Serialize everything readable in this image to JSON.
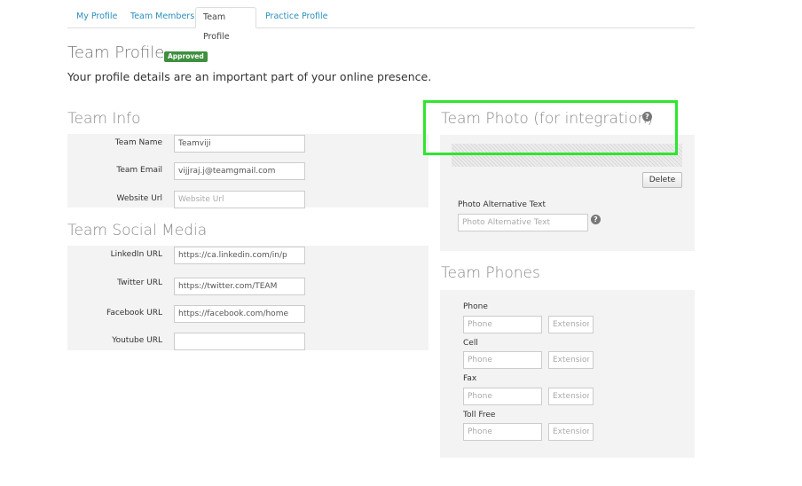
{
  "tabs": [
    {
      "label": "My Profile"
    },
    {
      "label": "Team Members"
    },
    {
      "label": "Team Profile"
    },
    {
      "label": "Practice Profile"
    }
  ],
  "header": {
    "title": "Team Profile",
    "status_badge": "Approved",
    "subtitle": "Your profile details are an important part of your online presence."
  },
  "team_info": {
    "title": "Team Info",
    "fields": [
      {
        "label": "Team Name",
        "value": "Teamviji",
        "placeholder": ""
      },
      {
        "label": "Team Email",
        "value": "vijjraj.j@teamgmail.com",
        "placeholder": ""
      },
      {
        "label": "Website Url",
        "value": "",
        "placeholder": "Website Url"
      }
    ]
  },
  "social_media": {
    "title": "Team Social Media",
    "fields": [
      {
        "label": "LinkedIn URL",
        "value": "https://ca.linkedin.com/in/p",
        "placeholder": ""
      },
      {
        "label": "Twitter URL",
        "value": "https://twitter.com/TEAM",
        "placeholder": ""
      },
      {
        "label": "Facebook URL",
        "value": "https://facebook.com/home",
        "placeholder": ""
      },
      {
        "label": "Youtube URL",
        "value": "",
        "placeholder": ""
      }
    ]
  },
  "team_photo": {
    "title": "Team Photo (for integration)",
    "help_icon": "question-circle",
    "delete_label": "Delete",
    "alt_text_label": "Photo Alternative Text",
    "alt_text_placeholder": "Photo Alternative Text",
    "alt_text_value": ""
  },
  "team_phones": {
    "title": "Team Phones",
    "phone_placeholder": "Phone",
    "extension_placeholder": "Extension",
    "rows": [
      {
        "label": "Phone"
      },
      {
        "label": "Cell"
      },
      {
        "label": "Fax"
      },
      {
        "label": "Toll Free"
      }
    ]
  },
  "colors": {
    "accent_link": "#2a8fbd",
    "badge_green": "#3f8f3f",
    "highlight_green": "#2ee62e",
    "panel_bg": "#f3f3f3"
  }
}
